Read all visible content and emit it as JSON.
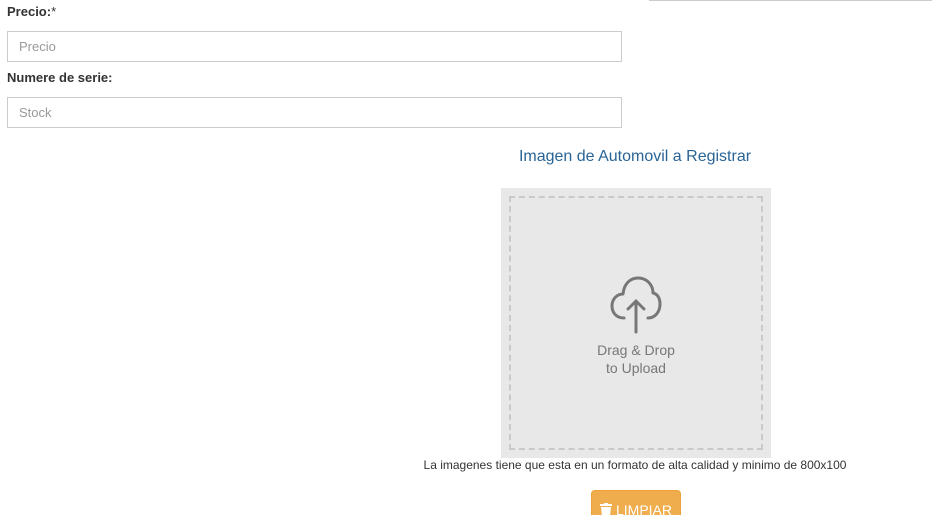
{
  "form": {
    "price": {
      "label": "Precio:",
      "required_mark": "*",
      "placeholder": "Precio",
      "value": ""
    },
    "serial": {
      "label": "Numere de serie:",
      "placeholder": "Stock",
      "value": ""
    }
  },
  "upload": {
    "title": "Imagen de Automovil a Registrar",
    "drop_line1": "Drag & Drop",
    "drop_line2": "to Upload",
    "icon": "cloud-upload-icon",
    "hint": "La imagenes tiene que esta en un formato de alta calidad y minimo de 800x100",
    "clear_label": "LIMPIAR",
    "clear_icon": "trash-icon"
  },
  "colors": {
    "title": "#2a6496",
    "dropzone_bg": "#e8e8e9",
    "button_bg": "#f0ad4e"
  }
}
